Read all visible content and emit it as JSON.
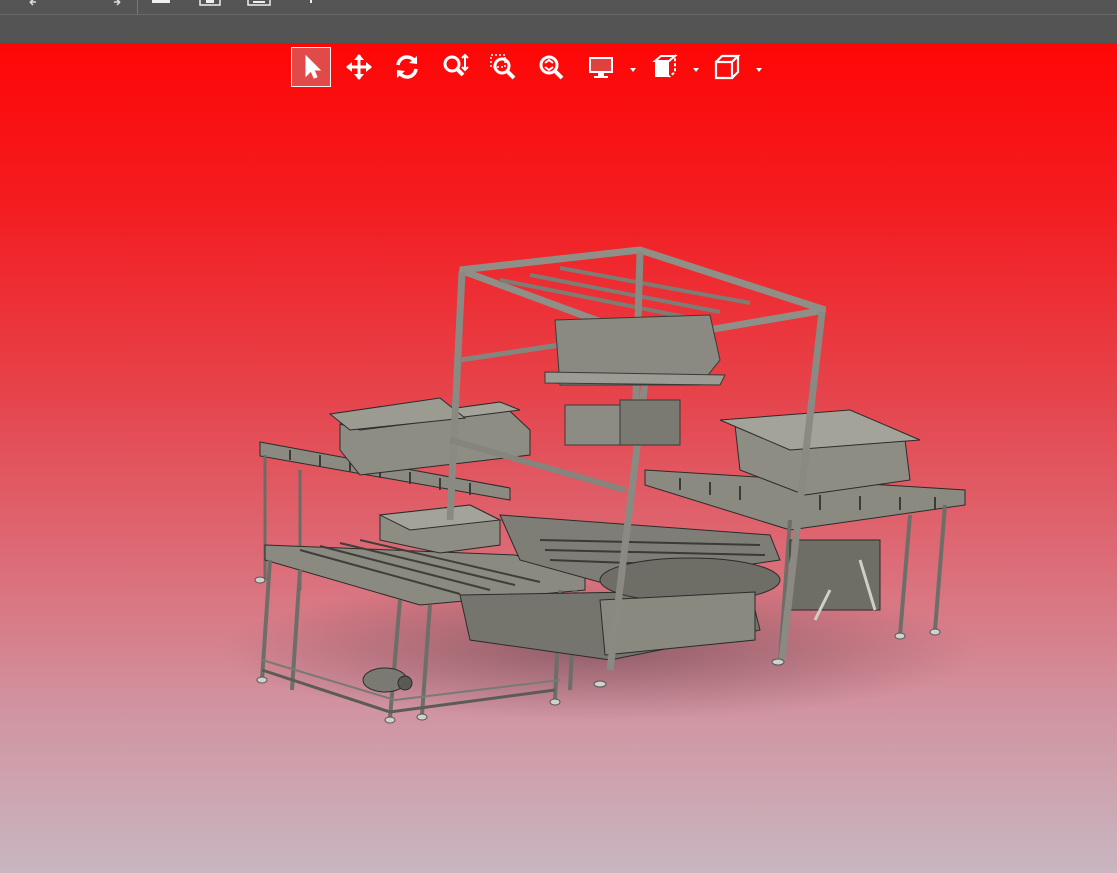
{
  "window": {
    "titlebar_icons": [
      "undo-icon",
      "redo-icon",
      "save-icon",
      "save-as-icon",
      "print-icon",
      "pin-icon"
    ]
  },
  "view_toolbar": {
    "tools": [
      {
        "name": "select-tool",
        "icon": "cursor-arrow-icon",
        "active": true
      },
      {
        "name": "pan-tool",
        "icon": "move-arrows-icon",
        "active": false
      },
      {
        "name": "rotate-tool",
        "icon": "rotate-icon",
        "active": false
      },
      {
        "name": "zoom-tool",
        "icon": "zoom-updown-icon",
        "active": false
      },
      {
        "name": "zoom-window-tool",
        "icon": "zoom-window-icon",
        "active": false
      },
      {
        "name": "zoom-fit-tool",
        "icon": "zoom-fit-icon",
        "active": false
      },
      {
        "name": "display-style-dropdown",
        "icon": "monitor-icon",
        "active": false
      },
      {
        "name": "section-view-dropdown",
        "icon": "section-cube-icon",
        "active": false
      },
      {
        "name": "view-orientation-dropdown",
        "icon": "cube-outline-icon",
        "active": false
      }
    ]
  },
  "colors": {
    "toolbar_bg": "#555555",
    "viewport_top": "#ff0606",
    "viewport_bottom": "#c8b6c0",
    "active_tool_bg": "#e24a4a",
    "model_gray": "#7a7a72"
  },
  "model": {
    "subject": "conveyor-machine-3d-assembly"
  }
}
